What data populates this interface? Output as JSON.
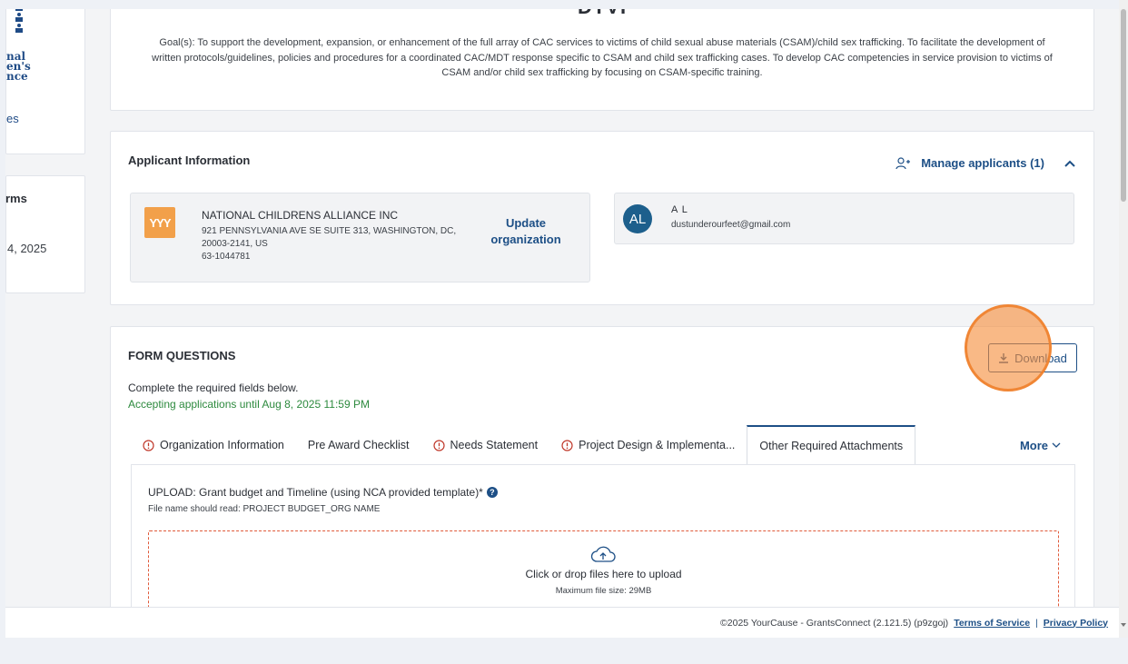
{
  "sidebar": {
    "logo_lines": [
      "nal",
      "en's",
      "nce"
    ],
    "link_partial": "es",
    "section_label_partial": "rms",
    "date_partial": "4, 2025"
  },
  "goal": {
    "title": "DTVI",
    "text": "Goal(s): To support the development, expansion, or enhancement of the full array of CAC services to victims of child sexual abuse materials (CSAM)/child sex trafficking. To facilitate the development of written protocols/guidelines, policies and procedures for a coordinated CAC/MDT response specific to CSAM and child sex trafficking cases. To develop CAC competencies in service provision to victims of CSAM and/or child sex trafficking by focusing on CSAM-specific training."
  },
  "applicant": {
    "title": "Applicant Information",
    "manage_label": "Manage applicants (1)",
    "org": {
      "logo_text": "YYY",
      "name": "NATIONAL CHILDRENS ALLIANCE INC",
      "address": "921 PENNSYLVANIA AVE SE SUITE 313, WASHINGTON, DC, 20003-2141, US",
      "ein": "63-1044781",
      "update_label": "Update organization"
    },
    "user": {
      "initials": "AL",
      "name": "A L",
      "email": "dustunderourfeet@gmail.com"
    }
  },
  "form": {
    "title": "FORM QUESTIONS",
    "download_label": "Download",
    "required_text": "Complete the required fields below.",
    "accepting_text": "Accepting applications until Aug 8, 2025 11:59 PM",
    "tabs": [
      {
        "label": "Organization Information",
        "warning": true,
        "active": false
      },
      {
        "label": "Pre Award Checklist",
        "warning": false,
        "active": false
      },
      {
        "label": "Needs Statement",
        "warning": true,
        "active": false
      },
      {
        "label": "Project Design & Implementa...",
        "warning": true,
        "active": false
      },
      {
        "label": "Other Required Attachments",
        "warning": false,
        "active": true
      }
    ],
    "more_label": "More",
    "upload": {
      "label": "UPLOAD: Grant budget and Timeline (using NCA provided template)*",
      "help": "?",
      "sub": "File name should read: PROJECT BUDGET_ORG NAME",
      "drop_text": "Click or drop files here to upload",
      "max_size": "Maximum file size: 29MB"
    }
  },
  "footer": {
    "copyright": "©2025 YourCause - GrantsConnect (2.121.5) (p9zgoj)",
    "terms": "Terms of Service",
    "separator": "|",
    "privacy": "Privacy Policy"
  },
  "colors": {
    "accent": "#1d4f86",
    "accepting_green": "#2d8a3e",
    "org_logo": "#f2a04a",
    "highlight": "#f58e3c",
    "dropzone_border": "#e05a3a"
  }
}
